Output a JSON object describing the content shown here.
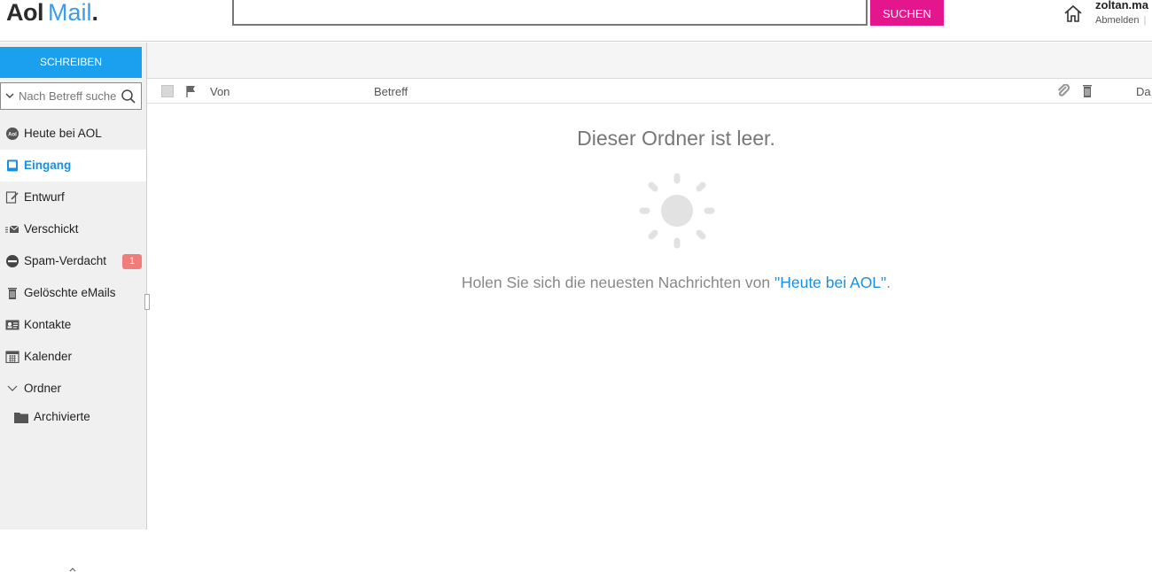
{
  "header": {
    "logo_aol": "Aol",
    "logo_mail": "Mail",
    "logo_dot": ".",
    "search_button": "SUCHEN",
    "username": "zoltan.ma",
    "logout": "Abmelden",
    "separator": "|"
  },
  "sidebar": {
    "compose_label": "SCHREIBEN",
    "search_placeholder": "Nach Betreff suche",
    "items": [
      {
        "label": "Heute bei AOL",
        "icon": "aol-icon"
      },
      {
        "label": "Eingang",
        "icon": "inbox-icon",
        "active": true
      },
      {
        "label": "Entwurf",
        "icon": "draft-icon"
      },
      {
        "label": "Verschickt",
        "icon": "sent-icon"
      },
      {
        "label": "Spam-Verdacht",
        "icon": "spam-icon",
        "badge": "1"
      },
      {
        "label": "Gelöschte eMails",
        "icon": "trash-icon"
      },
      {
        "label": "Kontakte",
        "icon": "contacts-icon"
      },
      {
        "label": "Kalender",
        "icon": "calendar-icon"
      },
      {
        "label": "Ordner",
        "icon": "chevron-down-icon"
      }
    ],
    "subfolders": [
      {
        "label": "Archivierte",
        "icon": "folder-icon"
      }
    ]
  },
  "list_header": {
    "from": "Von",
    "subject": "Betreff",
    "date": "Da"
  },
  "empty_state": {
    "title": "Dieser Ordner ist leer.",
    "message_prefix": "Holen Sie sich die neuesten Nachrichten von ",
    "link": "\"Heute bei AOL\"",
    "message_suffix": "."
  },
  "colors": {
    "accent_blue": "#1aa0ed",
    "search_pink": "#e4168e",
    "badge_red": "#f07c7c"
  }
}
